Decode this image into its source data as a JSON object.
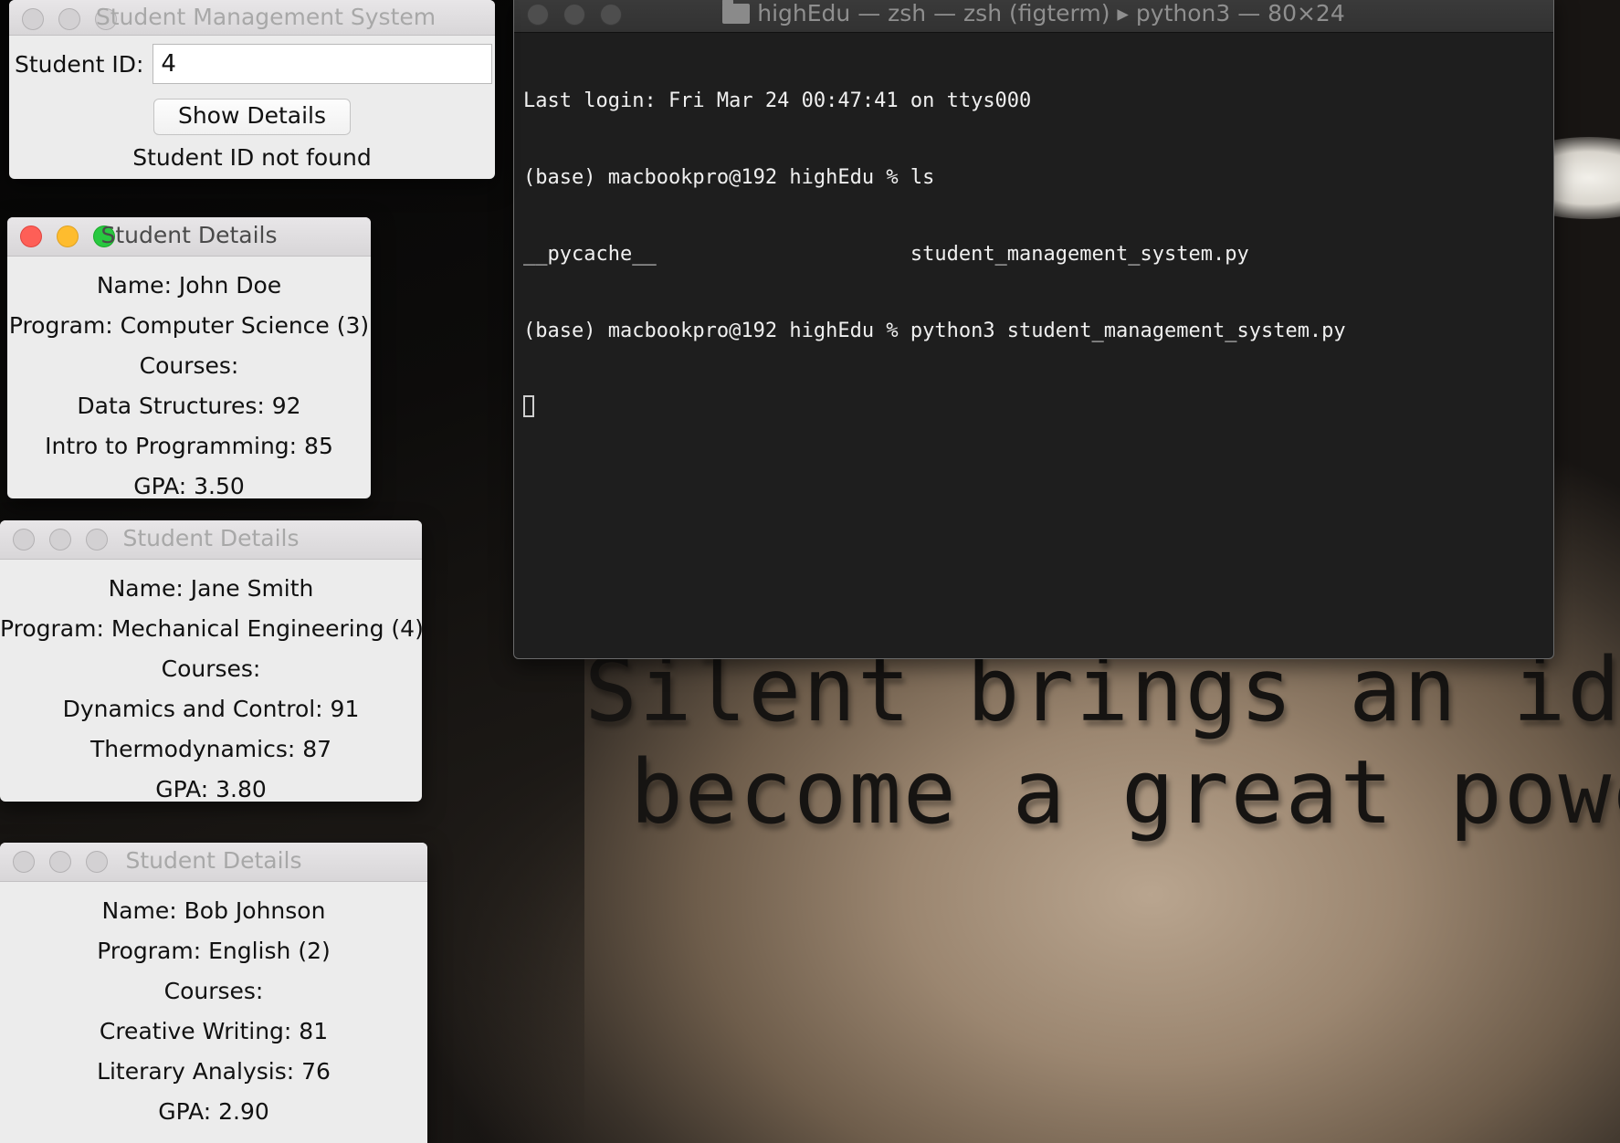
{
  "desktop": {
    "quote_line1": "Silent brings an idea",
    "quote_line2": "become a great powe"
  },
  "sms_window": {
    "title": "Student Management System",
    "id_label": "Student ID:",
    "id_value": "4",
    "show_button": "Show Details",
    "status": "Student ID not found"
  },
  "details_windows": [
    {
      "title": "Student Details",
      "name": "Name: John Doe",
      "program": "Program: Computer Science (3)",
      "courses_label": "Courses:",
      "course1": "Data Structures: 92",
      "course2": "Intro to Programming: 85",
      "gpa": "GPA: 3.50"
    },
    {
      "title": "Student Details",
      "name": "Name: Jane Smith",
      "program": "Program: Mechanical Engineering (4)",
      "courses_label": "Courses:",
      "course1": "Dynamics and Control: 91",
      "course2": "Thermodynamics: 87",
      "gpa": "GPA: 3.80"
    },
    {
      "title": "Student Details",
      "name": "Name: Bob Johnson",
      "program": "Program: English (2)",
      "courses_label": "Courses:",
      "course1": "Creative Writing: 81",
      "course2": "Literary Analysis: 76",
      "gpa": "GPA: 2.90"
    }
  ],
  "terminal": {
    "title": "highEdu — zsh — zsh (figterm) ▸ python3 — 80×24",
    "lines": [
      "Last login: Fri Mar 24 00:47:41 on ttys000",
      "(base) macbookpro@192 highEdu % ls",
      "__pycache__                     student_management_system.py",
      "(base) macbookpro@192 highEdu % python3 student_management_system.py"
    ]
  },
  "colors": {
    "close": "#fe5f57",
    "minimize": "#febc2e",
    "maximize": "#28c840",
    "terminal_bg": "#1e1e1e"
  }
}
